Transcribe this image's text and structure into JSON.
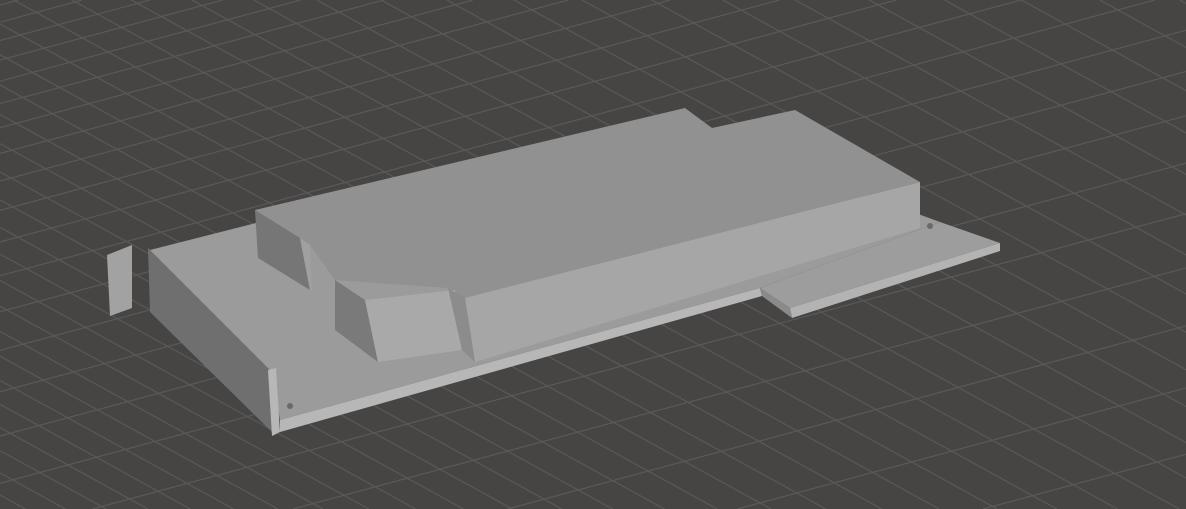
{
  "viewport": {
    "kind": "3d-scene-view",
    "colors": {
      "background": "#474544",
      "grid_line": "#5b5958",
      "model_top": "#919191",
      "model_front": "#a6a6a6",
      "model_side": "#767676",
      "plate_top": "#9b9b9b",
      "plate_edge": "#b7b7b7"
    }
  }
}
